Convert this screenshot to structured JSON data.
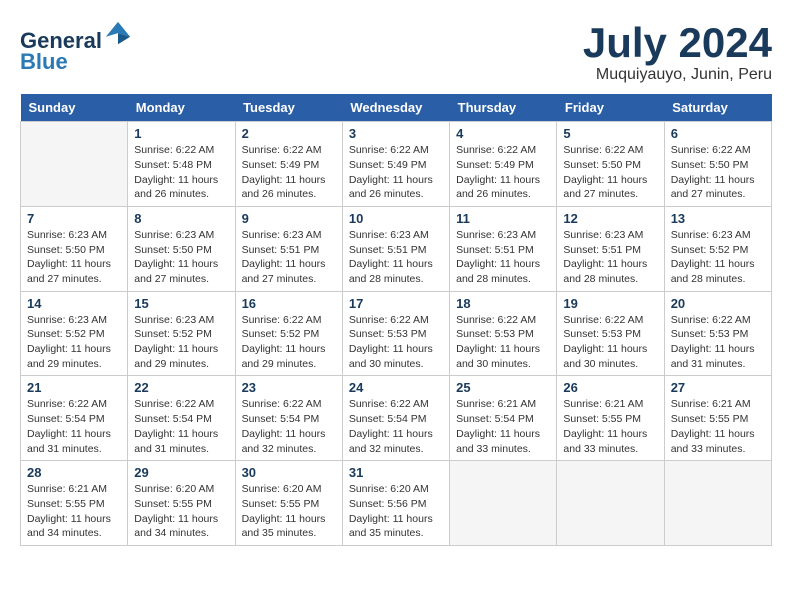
{
  "header": {
    "logo_line1": "General",
    "logo_line2": "Blue",
    "month_year": "July 2024",
    "location": "Muquiyauyo, Junin, Peru"
  },
  "days_of_week": [
    "Sunday",
    "Monday",
    "Tuesday",
    "Wednesday",
    "Thursday",
    "Friday",
    "Saturday"
  ],
  "weeks": [
    [
      {
        "day": "",
        "detail": ""
      },
      {
        "day": "1",
        "detail": "Sunrise: 6:22 AM\nSunset: 5:48 PM\nDaylight: 11 hours\nand 26 minutes."
      },
      {
        "day": "2",
        "detail": "Sunrise: 6:22 AM\nSunset: 5:49 PM\nDaylight: 11 hours\nand 26 minutes."
      },
      {
        "day": "3",
        "detail": "Sunrise: 6:22 AM\nSunset: 5:49 PM\nDaylight: 11 hours\nand 26 minutes."
      },
      {
        "day": "4",
        "detail": "Sunrise: 6:22 AM\nSunset: 5:49 PM\nDaylight: 11 hours\nand 26 minutes."
      },
      {
        "day": "5",
        "detail": "Sunrise: 6:22 AM\nSunset: 5:50 PM\nDaylight: 11 hours\nand 27 minutes."
      },
      {
        "day": "6",
        "detail": "Sunrise: 6:22 AM\nSunset: 5:50 PM\nDaylight: 11 hours\nand 27 minutes."
      }
    ],
    [
      {
        "day": "7",
        "detail": "Sunrise: 6:23 AM\nSunset: 5:50 PM\nDaylight: 11 hours\nand 27 minutes."
      },
      {
        "day": "8",
        "detail": "Sunrise: 6:23 AM\nSunset: 5:50 PM\nDaylight: 11 hours\nand 27 minutes."
      },
      {
        "day": "9",
        "detail": "Sunrise: 6:23 AM\nSunset: 5:51 PM\nDaylight: 11 hours\nand 27 minutes."
      },
      {
        "day": "10",
        "detail": "Sunrise: 6:23 AM\nSunset: 5:51 PM\nDaylight: 11 hours\nand 28 minutes."
      },
      {
        "day": "11",
        "detail": "Sunrise: 6:23 AM\nSunset: 5:51 PM\nDaylight: 11 hours\nand 28 minutes."
      },
      {
        "day": "12",
        "detail": "Sunrise: 6:23 AM\nSunset: 5:51 PM\nDaylight: 11 hours\nand 28 minutes."
      },
      {
        "day": "13",
        "detail": "Sunrise: 6:23 AM\nSunset: 5:52 PM\nDaylight: 11 hours\nand 28 minutes."
      }
    ],
    [
      {
        "day": "14",
        "detail": "Sunrise: 6:23 AM\nSunset: 5:52 PM\nDaylight: 11 hours\nand 29 minutes."
      },
      {
        "day": "15",
        "detail": "Sunrise: 6:23 AM\nSunset: 5:52 PM\nDaylight: 11 hours\nand 29 minutes."
      },
      {
        "day": "16",
        "detail": "Sunrise: 6:22 AM\nSunset: 5:52 PM\nDaylight: 11 hours\nand 29 minutes."
      },
      {
        "day": "17",
        "detail": "Sunrise: 6:22 AM\nSunset: 5:53 PM\nDaylight: 11 hours\nand 30 minutes."
      },
      {
        "day": "18",
        "detail": "Sunrise: 6:22 AM\nSunset: 5:53 PM\nDaylight: 11 hours\nand 30 minutes."
      },
      {
        "day": "19",
        "detail": "Sunrise: 6:22 AM\nSunset: 5:53 PM\nDaylight: 11 hours\nand 30 minutes."
      },
      {
        "day": "20",
        "detail": "Sunrise: 6:22 AM\nSunset: 5:53 PM\nDaylight: 11 hours\nand 31 minutes."
      }
    ],
    [
      {
        "day": "21",
        "detail": "Sunrise: 6:22 AM\nSunset: 5:54 PM\nDaylight: 11 hours\nand 31 minutes."
      },
      {
        "day": "22",
        "detail": "Sunrise: 6:22 AM\nSunset: 5:54 PM\nDaylight: 11 hours\nand 31 minutes."
      },
      {
        "day": "23",
        "detail": "Sunrise: 6:22 AM\nSunset: 5:54 PM\nDaylight: 11 hours\nand 32 minutes."
      },
      {
        "day": "24",
        "detail": "Sunrise: 6:22 AM\nSunset: 5:54 PM\nDaylight: 11 hours\nand 32 minutes."
      },
      {
        "day": "25",
        "detail": "Sunrise: 6:21 AM\nSunset: 5:54 PM\nDaylight: 11 hours\nand 33 minutes."
      },
      {
        "day": "26",
        "detail": "Sunrise: 6:21 AM\nSunset: 5:55 PM\nDaylight: 11 hours\nand 33 minutes."
      },
      {
        "day": "27",
        "detail": "Sunrise: 6:21 AM\nSunset: 5:55 PM\nDaylight: 11 hours\nand 33 minutes."
      }
    ],
    [
      {
        "day": "28",
        "detail": "Sunrise: 6:21 AM\nSunset: 5:55 PM\nDaylight: 11 hours\nand 34 minutes."
      },
      {
        "day": "29",
        "detail": "Sunrise: 6:20 AM\nSunset: 5:55 PM\nDaylight: 11 hours\nand 34 minutes."
      },
      {
        "day": "30",
        "detail": "Sunrise: 6:20 AM\nSunset: 5:55 PM\nDaylight: 11 hours\nand 35 minutes."
      },
      {
        "day": "31",
        "detail": "Sunrise: 6:20 AM\nSunset: 5:56 PM\nDaylight: 11 hours\nand 35 minutes."
      },
      {
        "day": "",
        "detail": ""
      },
      {
        "day": "",
        "detail": ""
      },
      {
        "day": "",
        "detail": ""
      }
    ]
  ]
}
